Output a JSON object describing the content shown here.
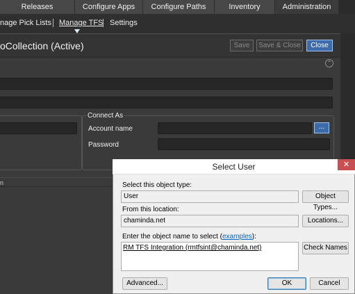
{
  "top_tabs": [
    "Releases",
    "Configure Apps",
    "Configure Paths",
    "Inventory",
    "Administration"
  ],
  "sub_nav": {
    "items": [
      "nage Pick Lists",
      "Manage TFS",
      "Settings"
    ]
  },
  "header": {
    "title": "oCollection (Active)",
    "save_label": "Save",
    "save_close_label": "Save & Close",
    "close_label": "Close",
    "collapse_glyph": "⌃"
  },
  "connect_as": {
    "group_label": "Connect As",
    "account_label": "Account name",
    "password_label": "Password",
    "browse_label": "..."
  },
  "lower_fragment": "n",
  "dialog": {
    "title": "Select User",
    "close_glyph": "✕",
    "object_type_label": "Select this object type:",
    "object_type_value": "User",
    "object_types_button": "Object Types...",
    "location_label": "From this location:",
    "location_value": "chaminda.net",
    "locations_button": "Locations...",
    "enter_label_prefix": "Enter the object name to select (",
    "enter_label_link": "examples",
    "enter_label_suffix": "):",
    "object_name_value": "RM TFS Integration (rmtfsint@chaminda.net)",
    "check_names_button": "Check Names",
    "advanced_button": "Advanced...",
    "ok_button": "OK",
    "cancel_button": "Cancel"
  },
  "colors": {
    "accent": "#3d6aa8",
    "dark_bg": "#3a3a3a",
    "dialog_bg": "#f0f0f0",
    "close_red": "#c75050"
  }
}
